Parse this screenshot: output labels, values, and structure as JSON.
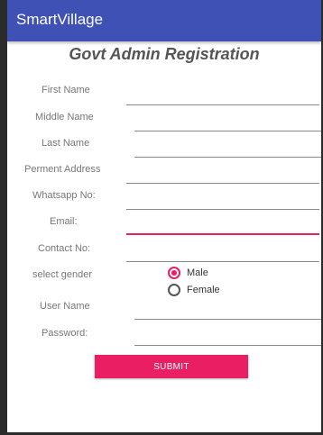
{
  "app_title": "SmartVillage",
  "page_heading": "Govt Admin Registration",
  "form": {
    "first_name_label": "First Name",
    "middle_name_label": "Middle Name",
    "last_name_label": "Last Name",
    "address_label": "Perment Address",
    "whatsapp_label": "Whatsapp No:",
    "email_label": "Email:",
    "contact_label": "Contact No:",
    "gender_label": "select gender",
    "gender_options": [
      "Male",
      "Female"
    ],
    "gender_selected": "Male",
    "username_label": "User Name",
    "password_label": "Password:",
    "submit_label": "SUBMIT"
  },
  "colors": {
    "app_bar": "#3f51b5",
    "accent": "#e91e63"
  }
}
